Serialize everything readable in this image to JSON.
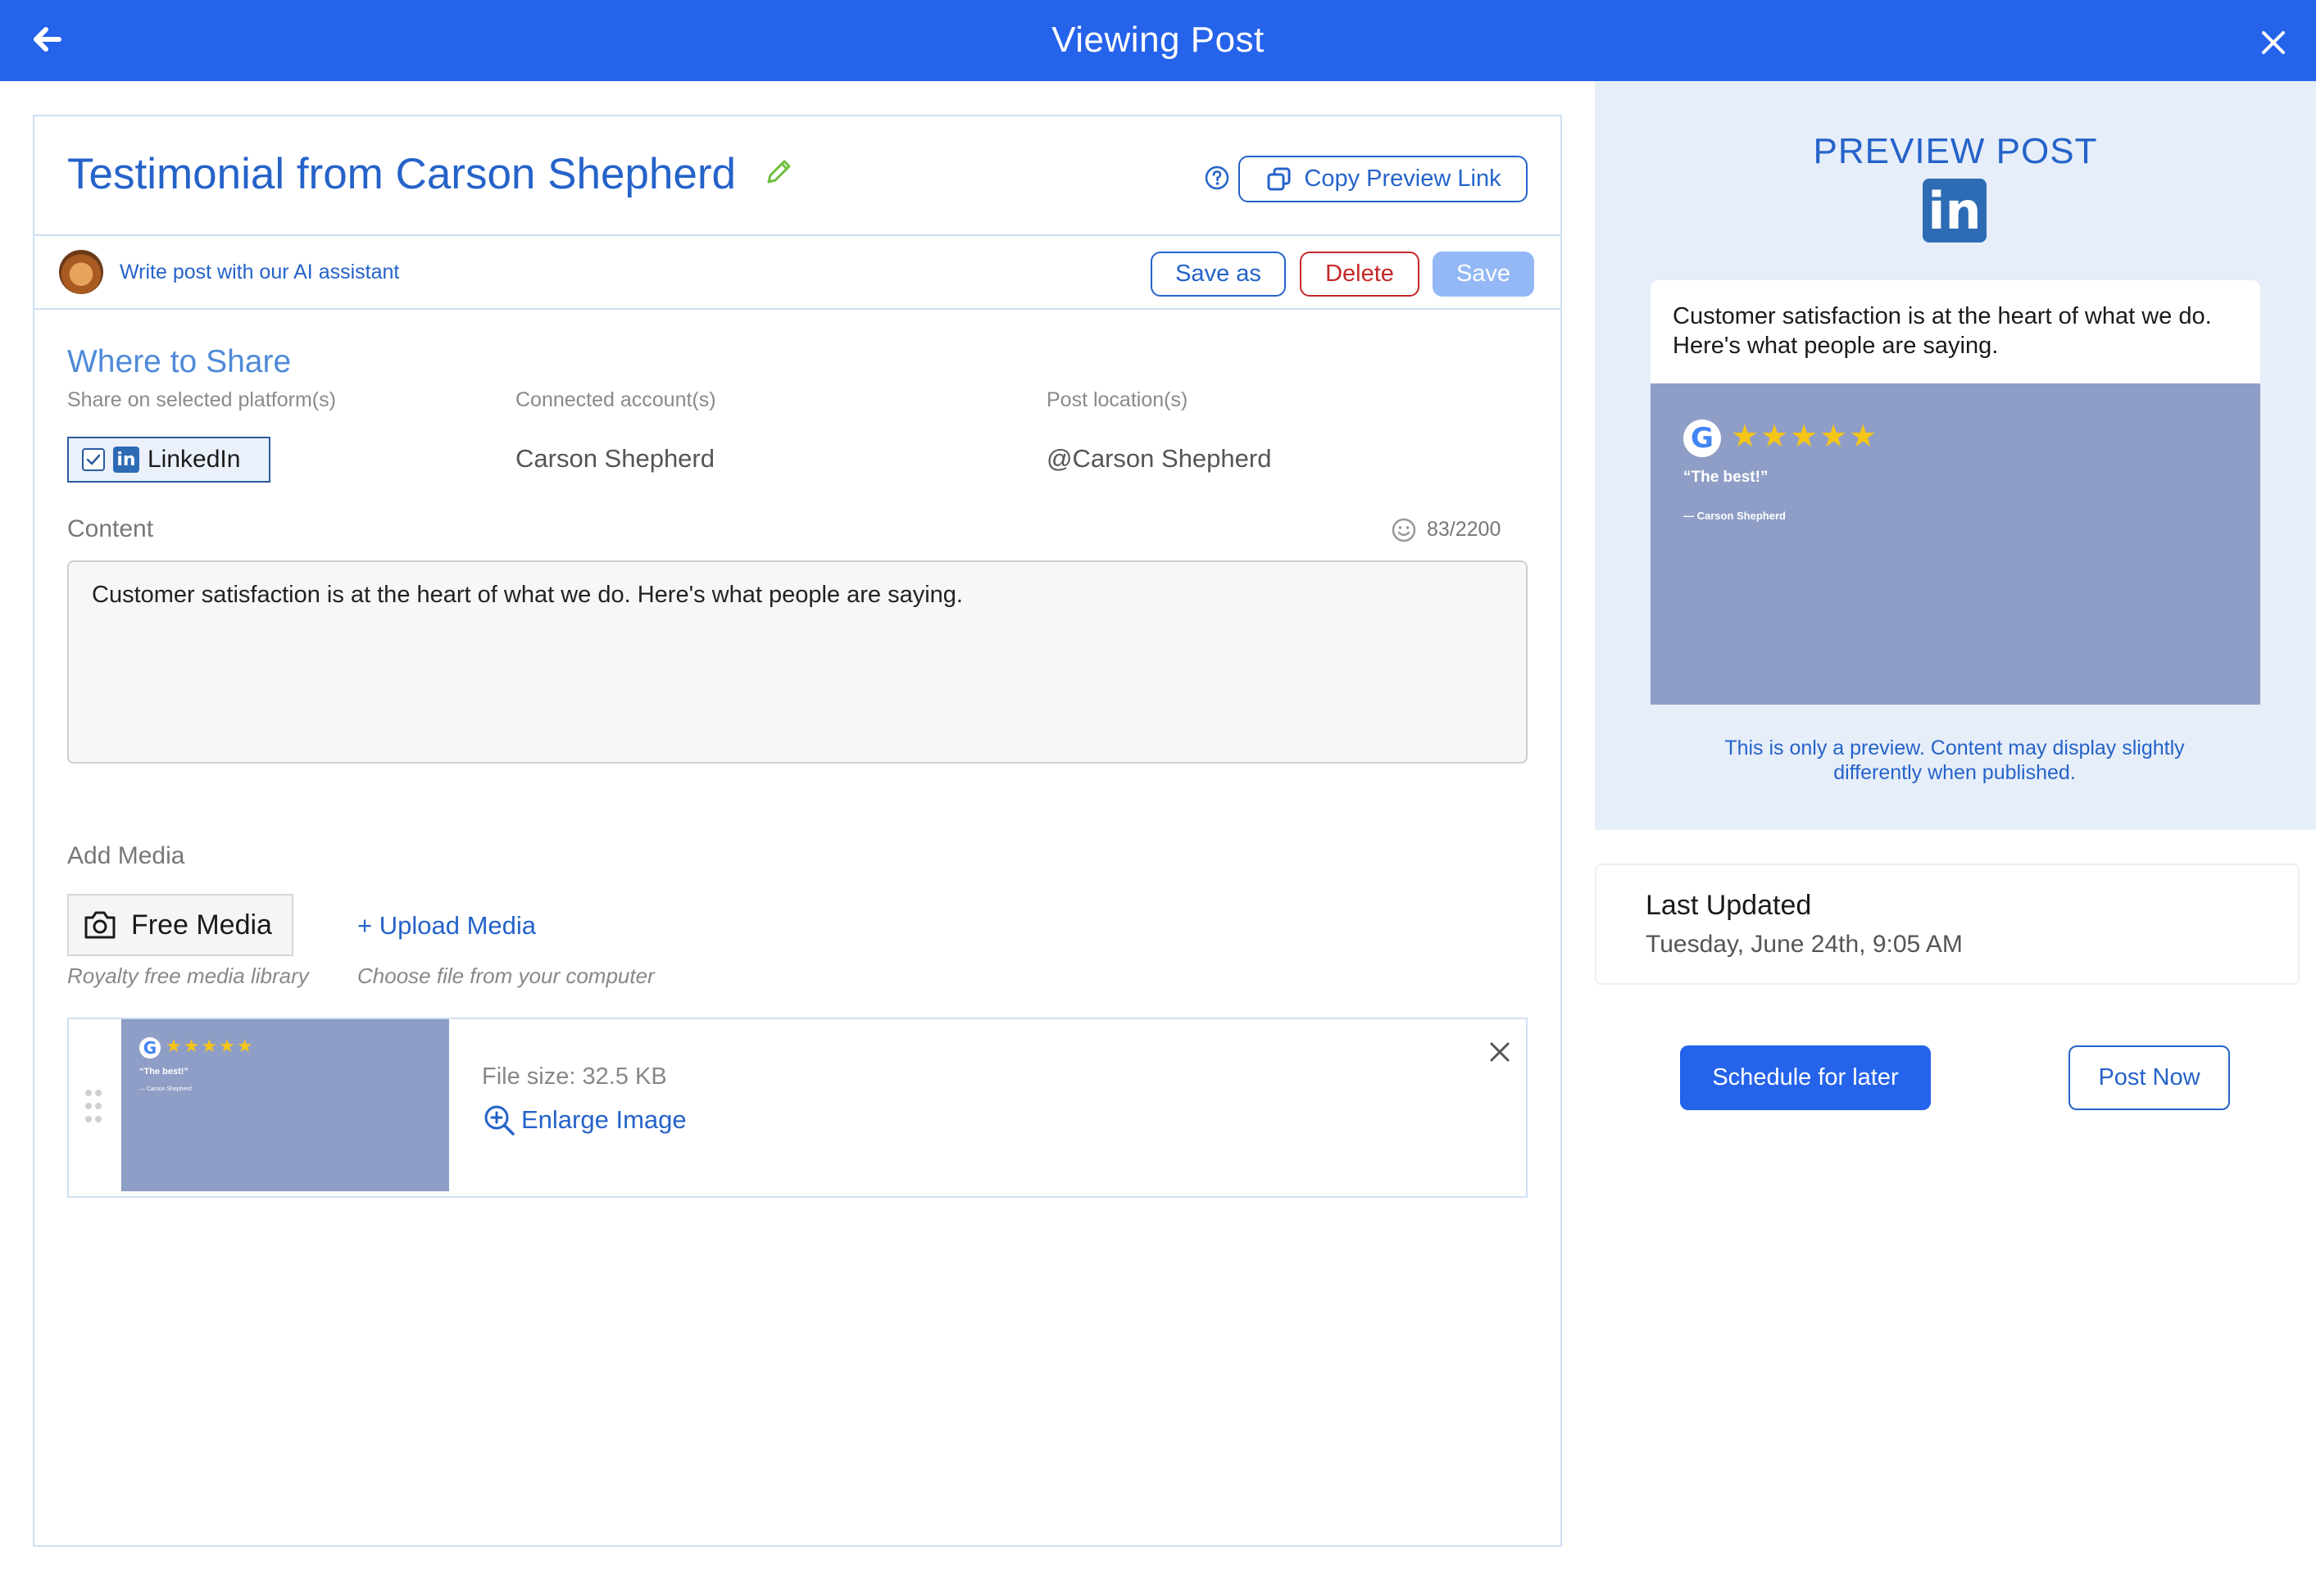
{
  "header": {
    "title": "Viewing Post"
  },
  "post": {
    "title": "Testimonial from Carson Shepherd",
    "copy_link_label": "Copy Preview Link"
  },
  "toolbar": {
    "ai_assistant_label": "Write post with our AI assistant",
    "save_as_label": "Save as",
    "delete_label": "Delete",
    "save_label": "Save"
  },
  "where_to_share": {
    "title": "Where to Share",
    "col_platforms": "Share on selected platform(s)",
    "col_accounts": "Connected account(s)",
    "col_location": "Post location(s)",
    "platform": "LinkedIn",
    "platform_checked": true,
    "account": "Carson Shepherd",
    "location": "@Carson Shepherd"
  },
  "content": {
    "label": "Content",
    "char_count": "83/2200",
    "text": "Customer satisfaction is at the heart of what we do. Here's what people are saying."
  },
  "media": {
    "label": "Add Media",
    "free_media_label": "Free Media",
    "free_media_hint": "Royalty free media library",
    "upload_label": "+ Upload Media",
    "upload_hint": "Choose file from your computer",
    "file_size": "File size: 32.5 KB",
    "enlarge_label": "Enlarge Image"
  },
  "testimonial": {
    "g_letter": "G",
    "stars": "★★★★★",
    "quote": "“The best!”",
    "author": "— Carson Shepherd"
  },
  "preview": {
    "title": "PREVIEW POST",
    "network_logo_text": "in",
    "text": "Customer satisfaction is at the heart of what we do. Here's what people are saying.",
    "note": "This is only a preview. Content may display slightly differently when published."
  },
  "last_updated": {
    "label": "Last Updated",
    "value": "Tuesday, June 24th, 9:05 AM"
  },
  "actions": {
    "schedule_label": "Schedule for later",
    "post_now_label": "Post Now"
  },
  "colors": {
    "primary": "#2563eb",
    "link": "#2563c9",
    "delete": "#c62828",
    "preview_bg": "#e6eef9",
    "testimonial_bg": "#8f9ec6",
    "linkedin": "#2d6cb5"
  }
}
